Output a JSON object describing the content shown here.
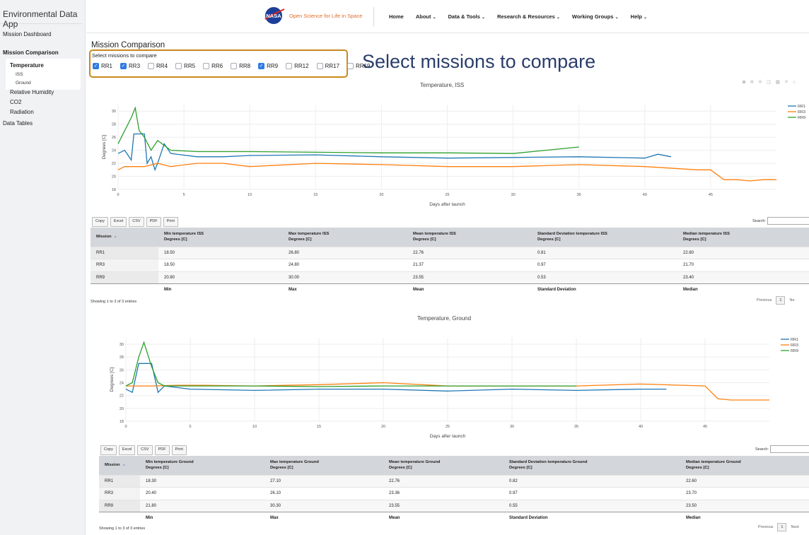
{
  "app_title": "Environmental Data App",
  "sidebar": {
    "mission_dashboard": "Mission Dashboard",
    "mission_comparison": "Mission Comparison",
    "temperature": "Temperature",
    "iss": "ISS",
    "ground": "Ground",
    "relative_humidity": "Relative Humidity",
    "co2": "CO2",
    "radiation": "Radiation",
    "data_tables": "Data Tables"
  },
  "nav": {
    "brand": "Open Science for Life in Space",
    "logo_text": "NASA",
    "links": [
      "Home",
      "About",
      "Data & Tools",
      "Research & Resources",
      "Working Groups",
      "Help"
    ]
  },
  "page": {
    "title": "Mission Comparison",
    "select_label": "Select missions to compare",
    "callout": "Select missions to compare",
    "missions": [
      {
        "label": "RR1",
        "checked": true
      },
      {
        "label": "RR3",
        "checked": true
      },
      {
        "label": "RR4",
        "checked": false
      },
      {
        "label": "RR5",
        "checked": false
      },
      {
        "label": "RR6",
        "checked": false
      },
      {
        "label": "RR8",
        "checked": false
      },
      {
        "label": "RR9",
        "checked": true
      },
      {
        "label": "RR12",
        "checked": false
      },
      {
        "label": "RR17",
        "checked": false
      },
      {
        "label": "RR19",
        "checked": false
      }
    ]
  },
  "dt_buttons": [
    "Copy",
    "Excel",
    "CSV",
    "PDF",
    "Print"
  ],
  "dt_search_label": "Search:",
  "colors": {
    "RR1": "#1f77b4",
    "RR3": "#ff7f0e",
    "RR9": "#2ca02c"
  },
  "chart_data": [
    {
      "type": "line",
      "title": "Temperature, ISS",
      "xlabel": "Days after launch",
      "ylabel": "Degrees [C]",
      "xlim": [
        0,
        50
      ],
      "ylim": [
        18,
        31
      ],
      "xticks": [
        0,
        5,
        10,
        15,
        20,
        25,
        30,
        35,
        40,
        45
      ],
      "yticks": [
        18,
        20,
        22,
        24,
        26,
        28,
        30
      ],
      "legend": "top-right",
      "grid": true,
      "series": [
        {
          "name": "RR1",
          "color": "#1f77b4",
          "x": [
            0,
            0.5,
            1,
            1.2,
            1.5,
            2,
            2.2,
            2.5,
            2.8,
            3,
            3.5,
            4,
            6,
            8,
            10,
            15,
            20,
            25,
            30,
            35,
            40,
            41,
            42
          ],
          "y": [
            23.5,
            24,
            22.5,
            26.5,
            26.5,
            26.5,
            22,
            23,
            21,
            22,
            25,
            23.5,
            23,
            23,
            23.2,
            23.3,
            23,
            22.8,
            22.9,
            23,
            22.8,
            23.4,
            23
          ]
        },
        {
          "name": "RR3",
          "color": "#ff7f0e",
          "x": [
            0,
            0.5,
            1,
            2,
            3,
            4,
            6,
            8,
            10,
            15,
            20,
            25,
            30,
            35,
            40,
            44,
            45,
            46,
            47,
            48,
            49,
            50
          ],
          "y": [
            21,
            21.5,
            21.5,
            21.5,
            22,
            21.5,
            22,
            22,
            21.5,
            22,
            21.8,
            21.5,
            21.5,
            21.8,
            21.5,
            21,
            21,
            19.5,
            19.5,
            19.3,
            19.5,
            19.5
          ]
        },
        {
          "name": "RR9",
          "color": "#2ca02c",
          "x": [
            0,
            0.5,
            1,
            1.3,
            1.6,
            2,
            2.5,
            3,
            4,
            6,
            8,
            10,
            15,
            20,
            25,
            30,
            35
          ],
          "y": [
            25,
            27,
            29,
            30.5,
            27,
            26,
            24,
            25.5,
            24,
            23.8,
            23.8,
            23.8,
            23.7,
            23.6,
            23.6,
            23.5,
            24.5
          ]
        }
      ]
    },
    {
      "type": "line",
      "title": "Temperature, Ground",
      "xlabel": "Days after launch",
      "ylabel": "Degrees [C]",
      "xlim": [
        0,
        50
      ],
      "ylim": [
        18,
        31
      ],
      "xticks": [
        0,
        5,
        10,
        15,
        20,
        25,
        30,
        35,
        40,
        45
      ],
      "yticks": [
        18,
        20,
        22,
        24,
        26,
        28,
        30
      ],
      "legend": "top-right",
      "grid": true,
      "series": [
        {
          "name": "RR1",
          "color": "#1f77b4",
          "x": [
            0,
            0.5,
            1,
            1.3,
            2,
            2.5,
            3,
            5,
            10,
            15,
            20,
            25,
            30,
            35,
            40,
            42
          ],
          "y": [
            23,
            22.5,
            27,
            27,
            27,
            22.5,
            23.5,
            23,
            22.8,
            23,
            23,
            22.7,
            23,
            22.8,
            23,
            23
          ]
        },
        {
          "name": "RR3",
          "color": "#ff7f0e",
          "x": [
            0,
            2,
            4,
            6,
            10,
            15,
            20,
            25,
            30,
            35,
            40,
            45,
            46,
            47,
            48,
            49,
            50
          ],
          "y": [
            23.5,
            23.5,
            23.6,
            23.6,
            23.5,
            23.7,
            24,
            23.5,
            23.5,
            23.5,
            23.8,
            23.5,
            21.5,
            21.3,
            21.3,
            21.3,
            21.3
          ]
        },
        {
          "name": "RR9",
          "color": "#2ca02c",
          "x": [
            0,
            0.5,
            1,
            1.4,
            2,
            2.5,
            3,
            5,
            10,
            15,
            20,
            25,
            30,
            35
          ],
          "y": [
            23.5,
            24,
            28,
            30.3,
            26.5,
            24,
            23.5,
            23.5,
            23.5,
            23.4,
            23.5,
            23.5,
            23.5,
            23.5
          ]
        }
      ]
    }
  ],
  "iss_table": {
    "headers": [
      {
        "l1": "Mission",
        "l2": ""
      },
      {
        "l1": "Min temperature ISS",
        "l2": "Degrees [C]"
      },
      {
        "l1": "Max temperature ISS",
        "l2": "Degrees [C]"
      },
      {
        "l1": "Mean temperature ISS",
        "l2": "Degrees [C]"
      },
      {
        "l1": "Standard Deviation temperature ISS",
        "l2": "Degrees [C]"
      },
      {
        "l1": "Median temperature ISS",
        "l2": "Degrees [C]"
      }
    ],
    "rows": [
      [
        "RR1",
        "18.50",
        "26.80",
        "22.76",
        "0.81",
        "22.60"
      ],
      [
        "RR3",
        "18.50",
        "24.80",
        "21.37",
        "0.97",
        "21.70"
      ],
      [
        "RR9",
        "20.80",
        "30.00",
        "23.55",
        "0.53",
        "23.40"
      ]
    ],
    "footer": [
      "",
      "Min",
      "Max",
      "Mean",
      "Standard Deviation",
      "Median"
    ],
    "info": "Showing 1 to 3 of 3 entries",
    "prev": "Previous",
    "page": "1",
    "next": "Ne"
  },
  "ground_table": {
    "headers": [
      {
        "l1": "Mission",
        "l2": ""
      },
      {
        "l1": "Min temperature Ground",
        "l2": "Degrees [C]"
      },
      {
        "l1": "Max temperature Ground",
        "l2": "Degrees [C]"
      },
      {
        "l1": "Mean temperature Ground",
        "l2": "Degrees [C]"
      },
      {
        "l1": "Standard Deviation temperature Ground",
        "l2": "Degrees [C]"
      },
      {
        "l1": "Median temperature Ground",
        "l2": "Degrees [C]"
      }
    ],
    "rows": [
      [
        "RR1",
        "18.30",
        "27.10",
        "22.76",
        "0.82",
        "22.60"
      ],
      [
        "RR3",
        "20.40",
        "26.10",
        "23.36",
        "0.97",
        "23.70"
      ],
      [
        "RR9",
        "21.80",
        "30.30",
        "23.55",
        "0.55",
        "23.50"
      ]
    ],
    "footer": [
      "",
      "Min",
      "Max",
      "Mean",
      "Standard Deviation",
      "Median"
    ],
    "info": "Showing 1 to 3 of 3 entries",
    "prev": "Previous",
    "page": "1",
    "next": "Next"
  }
}
